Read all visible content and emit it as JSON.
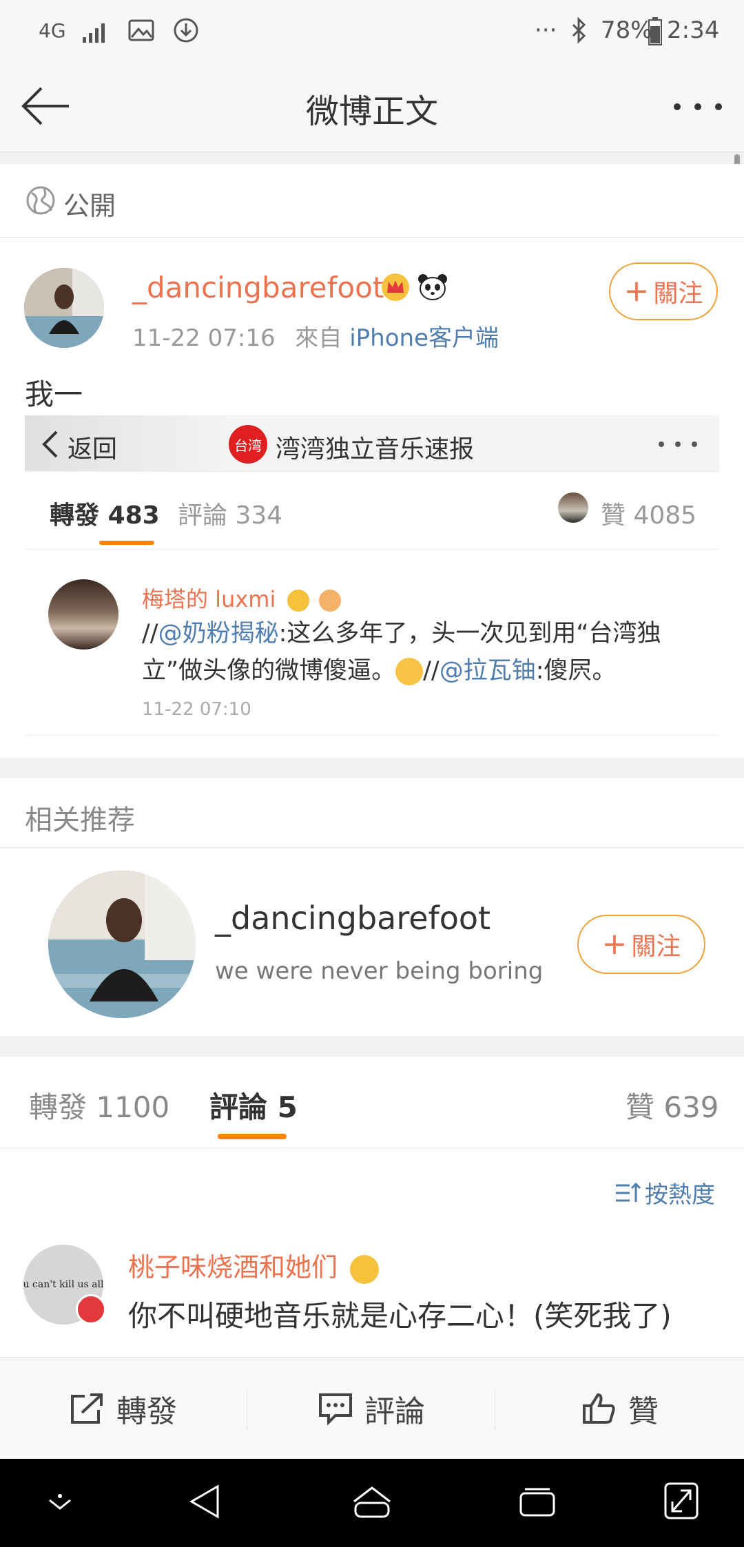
{
  "status_bar": {
    "network": "4G",
    "battery": "78%",
    "time": "2:34",
    "dots": "···"
  },
  "nav": {
    "title": "微博正文"
  },
  "visibility": {
    "label": "公開"
  },
  "post": {
    "username": "_dancingbarefoot",
    "time": "11-22 07:16",
    "source_prefix": "來自",
    "source": "iPhone客户端",
    "follow_label": "關注",
    "text": "我一"
  },
  "embedded": {
    "back_label": "返回",
    "account_name": "湾湾独立音乐速报",
    "account_badge": "台湾",
    "tabs": {
      "repost_label": "轉發",
      "repost_count": "483",
      "comment_label": "評論",
      "comment_count": "334",
      "like_label": "贊",
      "like_count": "4085"
    },
    "repost_item": {
      "username": "梅塔的 luxmi",
      "line1_prefix": "//",
      "mention1": "@奶粉揭秘",
      "line1_text": ":这么多年了，头一次见到用“台湾独",
      "line2_text": "立”做头像的微博傻逼。",
      "line2_prefix": "//",
      "mention2": "@拉瓦铀",
      "line2_end": ":傻屄。",
      "time": "11-22 07:10"
    }
  },
  "recommend": {
    "header": "相关推荐",
    "username": "_dancingbarefoot",
    "bio": "we were never being boring",
    "follow_label": "關注"
  },
  "stats_tabs": {
    "repost": "轉發 1100",
    "comment_label": "評論",
    "comment_count": "5",
    "like": "贊 639"
  },
  "sort": {
    "label": "按熱度"
  },
  "comment": {
    "username": "桃子味烧酒和她们",
    "avatar_text": "u can't kill us all",
    "text": "你不叫硬地音乐就是心存二心！(笑死我了)"
  },
  "bottom_bar": {
    "repost": "轉發",
    "comment": "評論",
    "like": "贊"
  },
  "colors": {
    "accent": "#eb7350",
    "link": "#507daf",
    "tab_underline": "#ff8200"
  }
}
